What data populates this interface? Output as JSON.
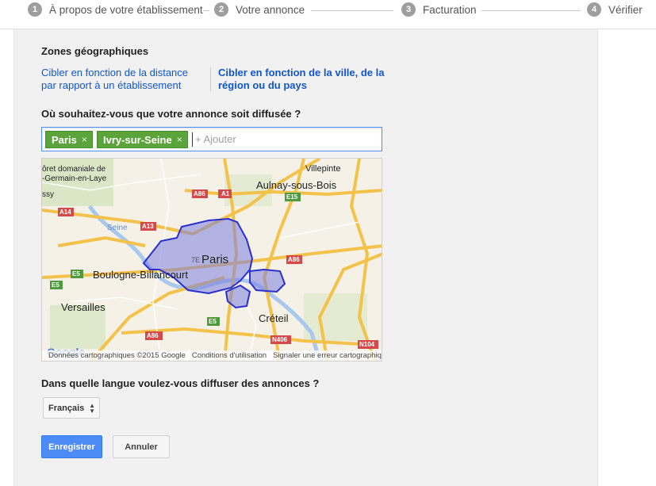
{
  "stepper": {
    "steps": [
      {
        "num": "1",
        "label": "À propos de votre établissement"
      },
      {
        "num": "2",
        "label": "Votre annonce"
      },
      {
        "num": "3",
        "label": "Facturation"
      },
      {
        "num": "4",
        "label": "Vérifier"
      }
    ]
  },
  "targeting": {
    "title": "Zones géographiques",
    "option_distance": "Cibler en fonction de la distance par rapport à un établissement",
    "option_city": "Cibler en fonction de la ville, de la région ou du pays"
  },
  "locations": {
    "question": "Où souhaitez-vous que votre annonce soit diffusée ?",
    "chips": [
      "Paris",
      "Ivry-sur-Seine"
    ],
    "chip_remove": "×",
    "add_placeholder": "+ Ajouter"
  },
  "map": {
    "labels": {
      "forest": "ôret domaniale de",
      "forest2": "-Germain-en-Laye",
      "issy": "ssy",
      "villepinte": "Villepinte",
      "aulnay": "Aulnay-sous-Bois",
      "paris": "Paris",
      "arr": "7E",
      "boulogne": "Boulogne-Billancourt",
      "versailles": "Versailles",
      "creteil": "Créteil",
      "seine": "Seine",
      "google": "Google"
    },
    "road_badges": {
      "a86_top": "A86",
      "a1": "A1",
      "e15": "E15",
      "a14": "A14",
      "a13": "A13",
      "a86_right": "A86",
      "e5_left": "E5",
      "e5_bottom": "E5",
      "a86_bottom": "A86",
      "n406": "N406",
      "n104": "N104",
      "e5_left2": "E5"
    },
    "footer": {
      "copyright": "Données cartographiques ©2015 Google",
      "terms": "Conditions d'utilisation",
      "report": "Signaler une erreur cartographique"
    }
  },
  "language": {
    "question": "Dans quelle langue voulez-vous diffuser des annonces ?",
    "selected": "Français"
  },
  "actions": {
    "save": "Enregistrer",
    "cancel": "Annuler"
  },
  "colors": {
    "link": "#1155cc",
    "chip": "#5ba33b",
    "primary_button": "#4d8cf4",
    "region_fill": "#7a7fe0",
    "region_stroke": "#2a2fd0"
  }
}
